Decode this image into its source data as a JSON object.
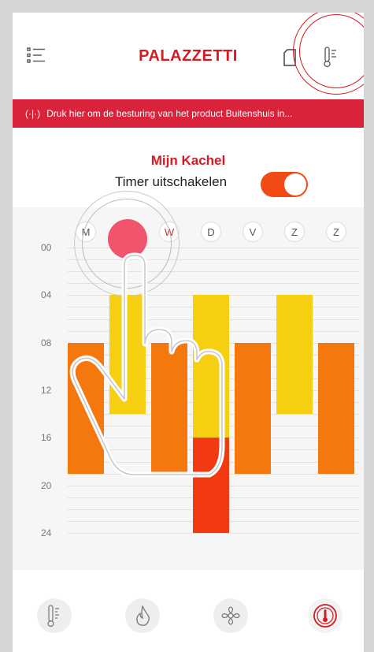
{
  "header": {
    "brand": "PALAZZETTI"
  },
  "banner": {
    "text": "Druk hier om de besturing van het product Buitenshuis in..."
  },
  "title": "Mijn Kachel",
  "timer": {
    "label": "Timer uitschakelen",
    "enabled": true
  },
  "days": [
    "M",
    "D",
    "W",
    "D",
    "V",
    "Z",
    "Z"
  ],
  "selected_day_index": 1,
  "hour_labels": [
    "00",
    "04",
    "08",
    "12",
    "16",
    "20",
    "24"
  ],
  "schedule": [
    {
      "day": "M",
      "blocks": [
        {
          "from": 8,
          "to": 19,
          "color": "#f5780f"
        }
      ]
    },
    {
      "day": "D",
      "blocks": [
        {
          "from": 4,
          "to": 14,
          "color": "#f7cf12"
        }
      ]
    },
    {
      "day": "W",
      "blocks": [
        {
          "from": 8,
          "to": 19,
          "color": "#f5780f"
        }
      ]
    },
    {
      "day": "D",
      "blocks": [
        {
          "from": 4,
          "to": 16,
          "color": "#f7cf12"
        },
        {
          "from": 16,
          "to": 24,
          "color": "#f23a12"
        }
      ]
    },
    {
      "day": "V",
      "blocks": [
        {
          "from": 8,
          "to": 19,
          "color": "#f5780f"
        }
      ]
    },
    {
      "day": "Z",
      "blocks": [
        {
          "from": 4,
          "to": 14,
          "color": "#f7cf12"
        }
      ]
    },
    {
      "day": "Z",
      "blocks": [
        {
          "from": 8,
          "to": 19,
          "color": "#f5780f"
        }
      ]
    }
  ],
  "bottom_nav": [
    {
      "icon": "thermometer-icon"
    },
    {
      "icon": "flame-icon"
    },
    {
      "icon": "fan-icon"
    },
    {
      "icon": "timer-gauge-icon",
      "active": true
    }
  ],
  "colors": {
    "brand": "#d71921",
    "banner": "#d8233a",
    "toggle": "#f24a14",
    "touch": "#f0556d"
  }
}
